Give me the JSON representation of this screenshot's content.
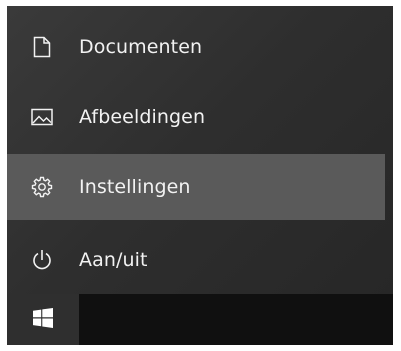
{
  "start_menu": {
    "items": [
      {
        "label": "Documenten",
        "icon": "document-icon",
        "highlighted": false
      },
      {
        "label": "Afbeeldingen",
        "icon": "pictures-icon",
        "highlighted": false
      },
      {
        "label": "Instellingen",
        "icon": "gear-icon",
        "highlighted": true
      },
      {
        "label": "Aan/uit",
        "icon": "power-icon",
        "highlighted": false
      }
    ]
  },
  "taskbar": {
    "start_icon": "windows-logo-icon"
  },
  "colors": {
    "menu_background": "#2e2e2e",
    "highlight": "#5a5a5a",
    "text": "#f2f2f2",
    "taskbar": "#101010",
    "start_button": "#2f2f2f"
  }
}
